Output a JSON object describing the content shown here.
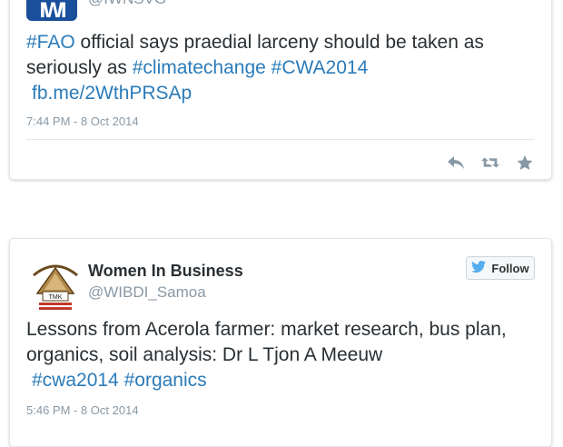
{
  "tweets": [
    {
      "handle": "@IWNSVG",
      "text_parts": [
        {
          "text": "#FAO",
          "hashtag": true
        },
        {
          "text": " official says praedial larceny should be taken as seriously as ",
          "hashtag": false
        },
        {
          "text": "#climatechange",
          "hashtag": true
        },
        {
          "text": " ",
          "hashtag": false
        },
        {
          "text": "#CWA2014",
          "hashtag": true
        }
      ],
      "link": "fb.me/2WthPRSAp",
      "time": "7:44 PM - 8 Oct 2014",
      "avatar_text": "IWI",
      "actions": [
        "reply-icon",
        "retweet-icon",
        "favorite-icon"
      ]
    },
    {
      "name": "Women In Business",
      "handle": "@WIBDI_Samoa",
      "text_line": "Lessons from Acerola farmer:  market research, bus plan, organics, soil analysis: Dr L Tjon A Meeuw",
      "hashtags": [
        "#cwa2014",
        "#organics"
      ],
      "time": "5:46 PM - 8 Oct 2014",
      "follow_label": "Follow",
      "avatar_text": "TMK"
    }
  ],
  "colors": {
    "link": "#2b7bb9",
    "meta": "#8899a6",
    "text": "#292f33",
    "avatar_blue": "#1a4f9c",
    "twitter_blue": "#55acee"
  }
}
